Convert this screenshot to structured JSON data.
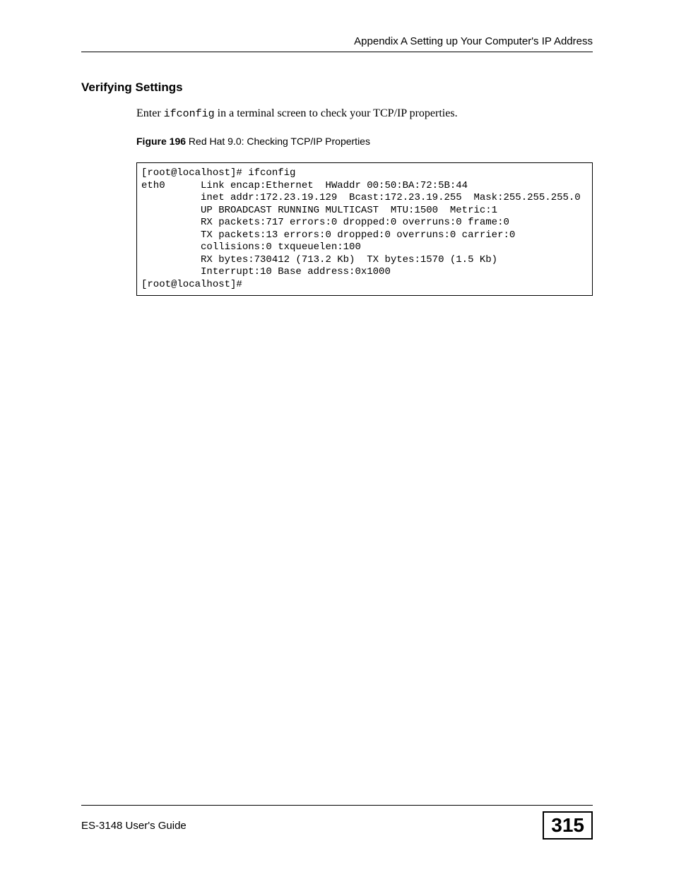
{
  "header": {
    "chapter": "Appendix A Setting up Your Computer's IP Address"
  },
  "section": {
    "heading": "Verifying Settings",
    "body_prefix": "Enter ",
    "body_code": "ifconfig",
    "body_suffix": " in a terminal screen to check your TCP/IP properties."
  },
  "figure": {
    "label": "Figure 196",
    "caption": "   Red Hat 9.0: Checking TCP/IP Properties"
  },
  "terminal": {
    "lines": [
      "[root@localhost]# ifconfig ",
      "eth0      Link encap:Ethernet  HWaddr 00:50:BA:72:5B:44  ",
      "          inet addr:172.23.19.129  Bcast:172.23.19.255  Mask:255.255.255.0",
      "          UP BROADCAST RUNNING MULTICAST  MTU:1500  Metric:1",
      "          RX packets:717 errors:0 dropped:0 overruns:0 frame:0",
      "          TX packets:13 errors:0 dropped:0 overruns:0 carrier:0",
      "          collisions:0 txqueuelen:100 ",
      "          RX bytes:730412 (713.2 Kb)  TX bytes:1570 (1.5 Kb)",
      "          Interrupt:10 Base address:0x1000 ",
      "[root@localhost]#"
    ]
  },
  "footer": {
    "guide": "ES-3148 User's Guide",
    "page": "315"
  }
}
